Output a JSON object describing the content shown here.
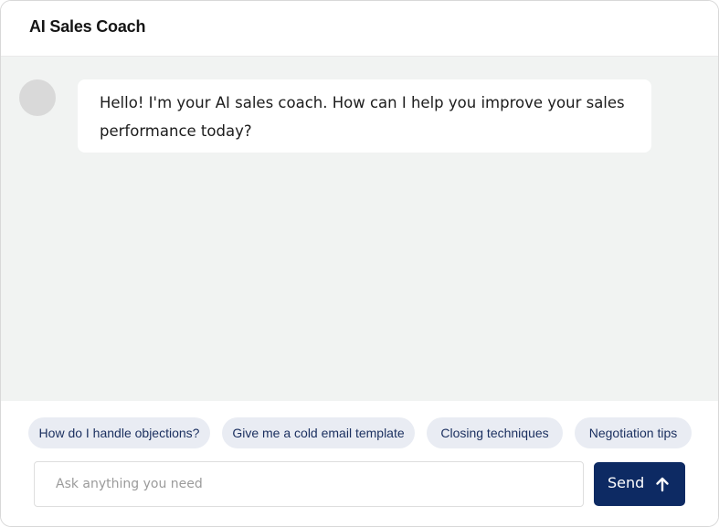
{
  "app": {
    "title": "AI Sales Coach"
  },
  "messages": [
    {
      "sender": "assistant",
      "text": "Hello! I'm your AI sales coach. How can I help you improve your sales performance today?"
    }
  ],
  "suggestions": [
    "How do I handle objections?",
    "Give me a cold email template",
    "Closing techniques",
    "Negotiation tips"
  ],
  "composer": {
    "placeholder": "Ask anything you need",
    "value": "",
    "send_label": "Send",
    "send_icon": "arrow-up-icon"
  },
  "colors": {
    "accent": "#0d2a63",
    "chip_bg": "#e9ecf3",
    "chip_text": "#1a2f5f",
    "messages_bg": "#f1f3f2"
  }
}
